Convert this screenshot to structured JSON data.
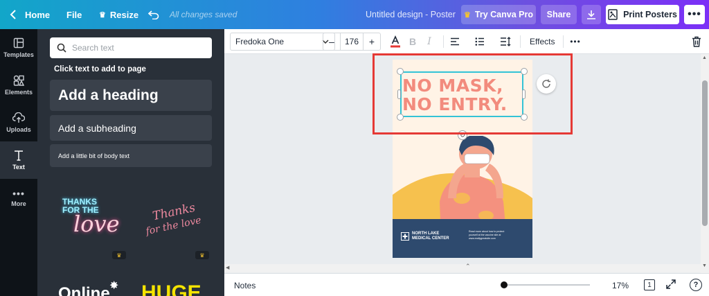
{
  "topbar": {
    "home": "Home",
    "file": "File",
    "resize": "Resize",
    "saved": "All changes saved",
    "title": "Untitled design - Poster",
    "try_pro": "Try Canva Pro",
    "share": "Share",
    "print": "Print Posters",
    "accent": "#7b2ff7"
  },
  "rail": {
    "items": [
      {
        "label": "Templates",
        "icon": "templates-icon"
      },
      {
        "label": "Elements",
        "icon": "elements-icon"
      },
      {
        "label": "Uploads",
        "icon": "uploads-icon"
      },
      {
        "label": "Text",
        "icon": "text-icon"
      },
      {
        "label": "More",
        "icon": "more-icon"
      }
    ]
  },
  "panel": {
    "search_placeholder": "Search text",
    "hint": "Click text to add to page",
    "heading": "Add a heading",
    "subheading": "Add a subheading",
    "body": "Add a little bit of body text",
    "thumb1": {
      "line1": "THANKS",
      "line2": "FOR THE",
      "line3": "love"
    },
    "thumb2": {
      "line1": "Thanks",
      "line2": "for the love"
    },
    "thumb3": "Online",
    "thumb4": "HUGE"
  },
  "toolbar": {
    "font": "Fredoka One",
    "size": "176",
    "effects": "Effects",
    "text_color": "#e53935"
  },
  "poster": {
    "line1": "NO MASK,",
    "line2": "NO ENTRY.",
    "org_line1": "NORTH LAKE",
    "org_line2": "MEDICAL CENTER",
    "info_line1": "Read more about how to protect",
    "info_line2": "yourself at the vaccine site at",
    "info_line3": "www.reallygreatsite.com",
    "headline_color": "#f28b7d"
  },
  "footer": {
    "notes": "Notes",
    "zoom": "17%",
    "page": "1"
  }
}
